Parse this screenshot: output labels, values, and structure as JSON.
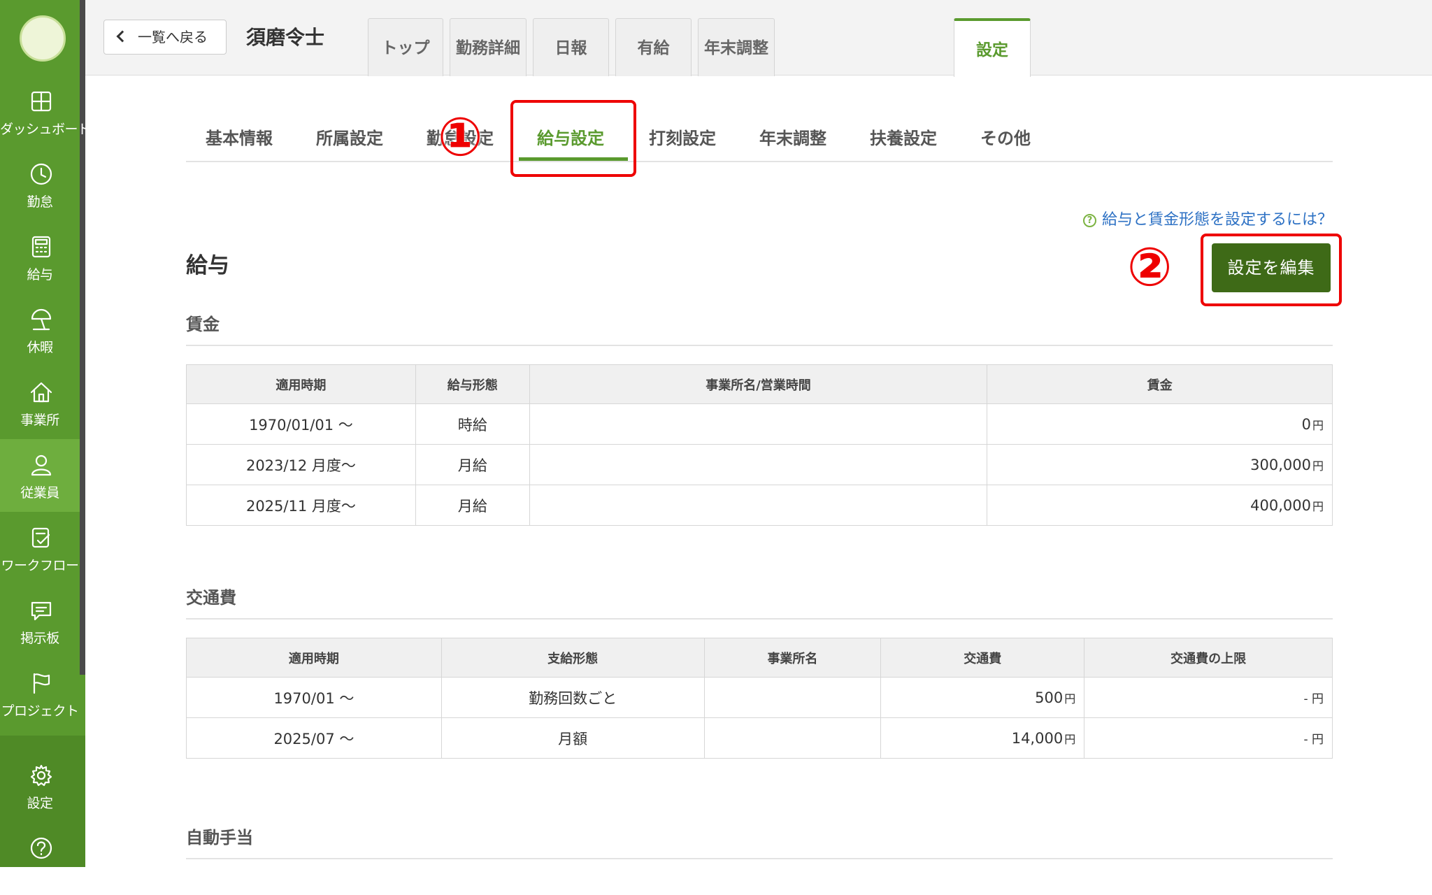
{
  "sidebar": {
    "items": [
      {
        "label": "ダッシュボード",
        "icon": "dashboard-icon"
      },
      {
        "label": "勤怠",
        "icon": "clock-icon"
      },
      {
        "label": "給与",
        "icon": "calculator-icon"
      },
      {
        "label": "休暇",
        "icon": "beach-umbrella-icon"
      },
      {
        "label": "事業所",
        "icon": "home-icon"
      },
      {
        "label": "従業員",
        "icon": "person-icon"
      },
      {
        "label": "ワークフロー",
        "icon": "workflow-check-icon"
      },
      {
        "label": "掲示板",
        "icon": "message-board-icon"
      },
      {
        "label": "プロジェクト",
        "icon": "flag-icon"
      },
      {
        "label": "設定",
        "icon": "gear-icon"
      },
      {
        "label": "ヘルプ",
        "icon": "help-icon"
      }
    ],
    "active": "従業員"
  },
  "header": {
    "back_label": "一覧へ戻る",
    "employee_name": "須磨令士",
    "tabs": [
      "トップ",
      "勤務詳細",
      "日報",
      "有給",
      "年末調整",
      "設定"
    ],
    "active_tab": "設定"
  },
  "subtabs": {
    "items": [
      "基本情報",
      "所属設定",
      "勤怠設定",
      "給与設定",
      "打刻設定",
      "年末調整",
      "扶養設定",
      "その他"
    ],
    "active": "給与設定"
  },
  "annotations": {
    "step1": "①",
    "step2": "②",
    "accent": "#e00000"
  },
  "help_link": "給与と賃金形態を設定するには？",
  "page_heading": "給与",
  "edit_button": "設定を編集",
  "wage": {
    "title": "賃金",
    "headers": [
      "適用時期",
      "給与形態",
      "事業所名/営業時間",
      "賃金"
    ],
    "rows": [
      {
        "period": "1970/01/01 〜",
        "type": "時給",
        "office": "",
        "amount": "0",
        "unit": "円"
      },
      {
        "period": "2023/12 月度〜",
        "type": "月給",
        "office": "",
        "amount": "300,000",
        "unit": "円"
      },
      {
        "period": "2025/11 月度〜",
        "type": "月給",
        "office": "",
        "amount": "400,000",
        "unit": "円"
      }
    ]
  },
  "commute": {
    "title": "交通費",
    "headers": [
      "適用時期",
      "支給形態",
      "事業所名",
      "交通費",
      "交通費の上限"
    ],
    "rows": [
      {
        "period": "1970/01 〜",
        "type": "勤務回数ごと",
        "office": "",
        "amount": "500",
        "unit": "円",
        "limit": "- 円"
      },
      {
        "period": "2025/07 〜",
        "type": "月額",
        "office": "",
        "amount": "14,000",
        "unit": "円",
        "limit": "- 円"
      }
    ]
  },
  "auto_allowance": {
    "title": "自動手当"
  },
  "colors": {
    "brand": "#5a9a2e",
    "button": "#3e6a17",
    "link": "#2d71c4"
  }
}
